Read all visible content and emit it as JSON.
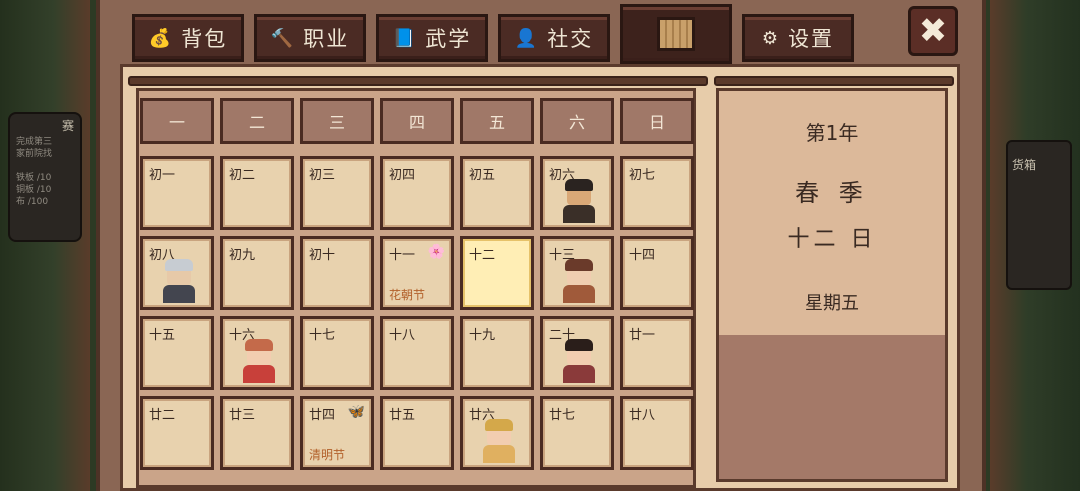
{
  "tabs": [
    {
      "label": "背包",
      "icon": "bag-icon",
      "glyph": "💰"
    },
    {
      "label": "职业",
      "icon": "hammer-icon",
      "glyph": "🔨"
    },
    {
      "label": "武学",
      "icon": "book-icon",
      "glyph": "📘"
    },
    {
      "label": "社交",
      "icon": "person-icon",
      "glyph": "👤"
    },
    {
      "label": "",
      "icon": "calendar-scroll-icon",
      "glyph": ""
    },
    {
      "label": "设置",
      "icon": "gear-icon",
      "glyph": "⚙"
    }
  ],
  "close_glyph": "✖",
  "side_left": {
    "title": "赛",
    "lines": [
      "完成第三",
      "家前院找",
      "",
      "铁板 /10",
      "铜板 /10",
      "布 /100"
    ]
  },
  "side_right": {
    "label": "货箱"
  },
  "weekdays": [
    "一",
    "二",
    "三",
    "四",
    "五",
    "六",
    "日"
  ],
  "days": [
    {
      "label": "初一"
    },
    {
      "label": "初二"
    },
    {
      "label": "初三"
    },
    {
      "label": "初四"
    },
    {
      "label": "初五"
    },
    {
      "label": "初六",
      "npc": "bearded-man"
    },
    {
      "label": "初七"
    },
    {
      "label": "初八",
      "npc": "grey-haired-elder"
    },
    {
      "label": "初九"
    },
    {
      "label": "初十"
    },
    {
      "label": "十一",
      "festival": "花朝节",
      "flower": "🌸"
    },
    {
      "label": "十二",
      "today": true
    },
    {
      "label": "十三",
      "npc": "long-haired-woman"
    },
    {
      "label": "十四"
    },
    {
      "label": "十五"
    },
    {
      "label": "十六",
      "npc": "red-robed-girl"
    },
    {
      "label": "十七"
    },
    {
      "label": "十八"
    },
    {
      "label": "十九"
    },
    {
      "label": "二十",
      "npc": "bun-haired-girl"
    },
    {
      "label": "廿一"
    },
    {
      "label": "廿二"
    },
    {
      "label": "廿三"
    },
    {
      "label": "廿四",
      "festival": "清明节",
      "flower": "🦋"
    },
    {
      "label": "廿五"
    },
    {
      "label": "廿六",
      "npc": "hooded-girl"
    },
    {
      "label": "廿七"
    },
    {
      "label": "廿八"
    }
  ],
  "info": {
    "year": "第1年",
    "season": "春 季",
    "day": "十二 日",
    "weekday": "星期五"
  },
  "colors": {
    "frame": "#8a6654",
    "tab": "#4b2b24",
    "cell": "#e8d2ae",
    "today": "#ffeeb5",
    "festival": "#b2602a"
  }
}
